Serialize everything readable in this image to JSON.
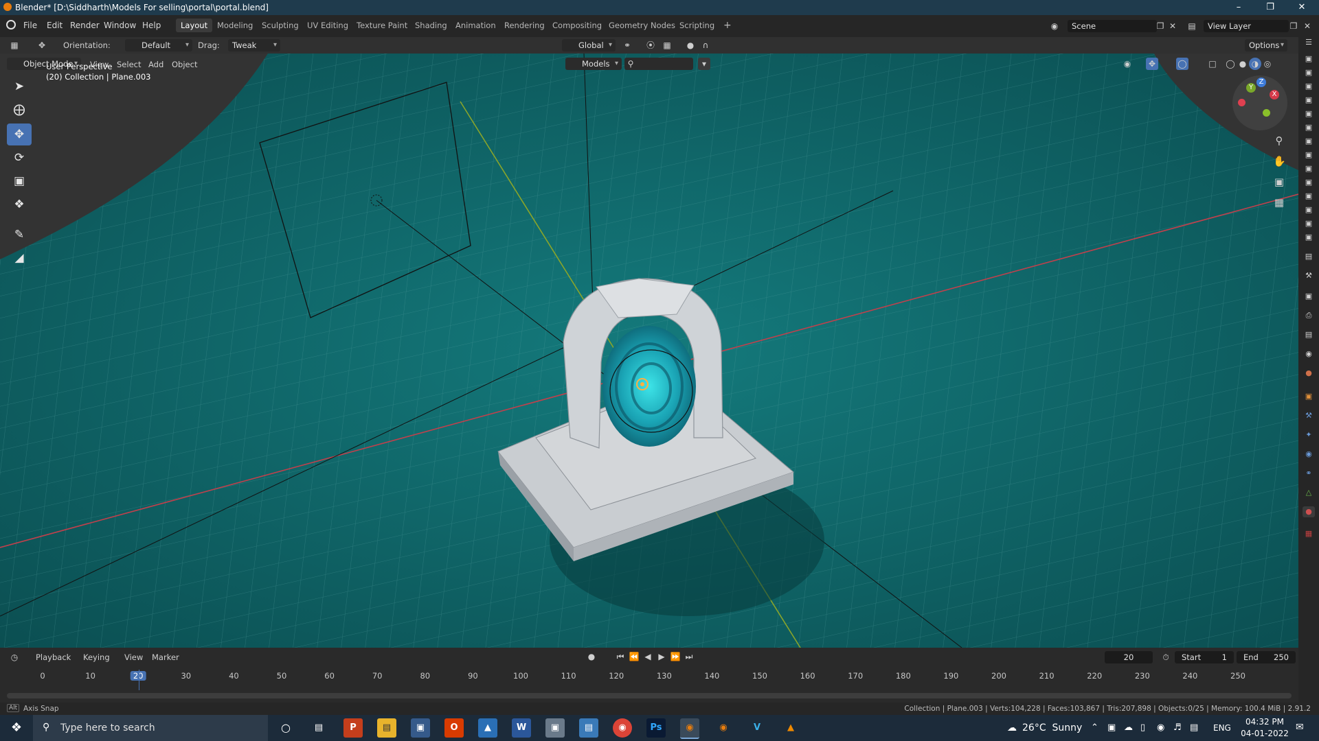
{
  "window": {
    "title": "Blender* [D:\\Siddharth\\Models For selling\\portal\\portal.blend]"
  },
  "menubar": {
    "menus": [
      "File",
      "Edit",
      "Render",
      "Window",
      "Help"
    ],
    "workspaces": [
      "Layout",
      "Modeling",
      "Sculpting",
      "UV Editing",
      "Texture Paint",
      "Shading",
      "Animation",
      "Rendering",
      "Compositing",
      "Geometry Nodes",
      "Scripting"
    ],
    "add_workspace": "+",
    "scene": "Scene",
    "view_layer": "View Layer"
  },
  "header": {
    "orientation_label": "Orientation:",
    "orientation_value": "Default",
    "drag_label": "Drag:",
    "drag_value": "Tweak",
    "transform_orientation": "Global",
    "options": "Options"
  },
  "viewport_header": {
    "mode": "Object Mode",
    "menus": [
      "View",
      "Select",
      "Add",
      "Object"
    ],
    "collection_filter": "Models"
  },
  "viewport": {
    "perspective": "User Perspective",
    "collection_info": "(20) Collection | Plane.003",
    "gizmo": {
      "z": "Z",
      "y": "Y",
      "x": "X"
    }
  },
  "timeline": {
    "menus": [
      "Playback",
      "Keying",
      "View",
      "Marker"
    ],
    "current_frame": "20",
    "start_label": "Start",
    "start_value": "1",
    "end_label": "End",
    "end_value": "250",
    "ticks": [
      "0",
      "10",
      "20",
      "30",
      "40",
      "50",
      "60",
      "70",
      "80",
      "90",
      "100",
      "110",
      "120",
      "130",
      "140",
      "150",
      "160",
      "170",
      "180",
      "190",
      "200",
      "210",
      "220",
      "230",
      "240",
      "250"
    ]
  },
  "status": {
    "left": "Axis Snap",
    "right": "Collection | Plane.003 | Verts:104,228 | Faces:103,867 | Tris:207,898 | Objects:0/25 | Memory: 100.4 MiB | 2.91.2"
  },
  "taskbar": {
    "search_placeholder": "Type here to search",
    "weather": "26°C  Sunny",
    "lang": "ENG",
    "time": "04:32 PM",
    "date": "04-01-2022"
  },
  "colors": {
    "accent": "#4772b3",
    "floor": "#0f5d60",
    "x_axis": "#c2404c",
    "y_axis": "#8aa52a"
  }
}
